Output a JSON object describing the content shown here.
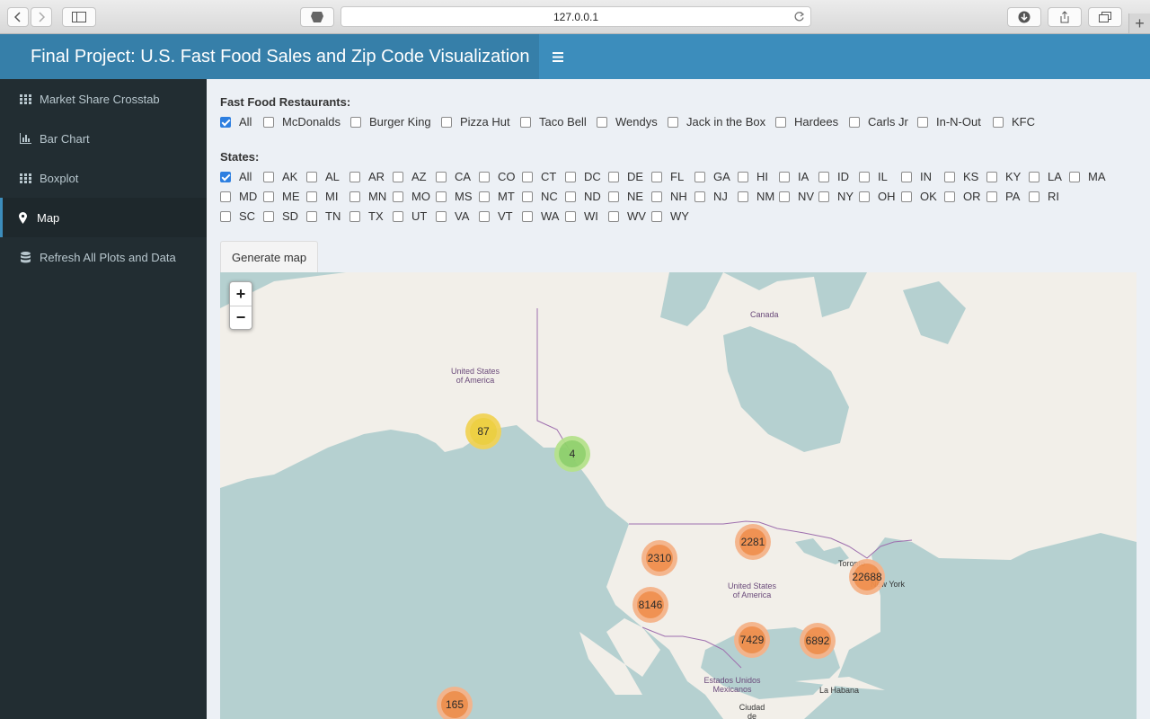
{
  "browser": {
    "url": "127.0.0.1"
  },
  "header": {
    "title": "Final Project: U.S. Fast Food Sales and Zip Code Visualization"
  },
  "sidebar": {
    "items": [
      {
        "label": "Market Share Crosstab",
        "icon": "grid-icon"
      },
      {
        "label": "Bar Chart",
        "icon": "bar-chart-icon"
      },
      {
        "label": "Boxplot",
        "icon": "grid-icon"
      },
      {
        "label": "Map",
        "icon": "map-marker-icon",
        "active": true
      },
      {
        "label": "Refresh All Plots and Data",
        "icon": "database-icon"
      }
    ]
  },
  "restaurants": {
    "label": "Fast Food Restaurants:",
    "options": [
      {
        "label": "All",
        "checked": true
      },
      {
        "label": "McDonalds",
        "checked": false
      },
      {
        "label": "Burger King",
        "checked": false
      },
      {
        "label": "Pizza Hut",
        "checked": false
      },
      {
        "label": "Taco Bell",
        "checked": false
      },
      {
        "label": "Wendys",
        "checked": false
      },
      {
        "label": "Jack in the Box",
        "checked": false
      },
      {
        "label": "Hardees",
        "checked": false
      },
      {
        "label": "Carls Jr",
        "checked": false
      },
      {
        "label": "In-N-Out",
        "checked": false
      },
      {
        "label": "KFC",
        "checked": false
      }
    ]
  },
  "states": {
    "label": "States:",
    "rows": [
      [
        {
          "label": "All",
          "checked": true
        },
        {
          "label": "AK"
        },
        {
          "label": "AL"
        },
        {
          "label": "AR"
        },
        {
          "label": "AZ"
        },
        {
          "label": "CA"
        },
        {
          "label": "CO"
        },
        {
          "label": "CT"
        },
        {
          "label": "DC"
        },
        {
          "label": "DE"
        },
        {
          "label": "FL"
        },
        {
          "label": "GA"
        },
        {
          "label": "HI"
        },
        {
          "label": "IA"
        },
        {
          "label": "ID"
        },
        {
          "label": "IL"
        },
        {
          "label": "IN"
        },
        {
          "label": "KS"
        },
        {
          "label": "KY"
        },
        {
          "label": "LA"
        },
        {
          "label": "MA"
        }
      ],
      [
        {
          "label": "MD"
        },
        {
          "label": "ME"
        },
        {
          "label": "MI"
        },
        {
          "label": "MN"
        },
        {
          "label": "MO"
        },
        {
          "label": "MS"
        },
        {
          "label": "MT"
        },
        {
          "label": "NC"
        },
        {
          "label": "ND"
        },
        {
          "label": "NE"
        },
        {
          "label": "NH"
        },
        {
          "label": "NJ"
        },
        {
          "label": "NM"
        },
        {
          "label": "NV"
        },
        {
          "label": "NY"
        },
        {
          "label": "OH"
        },
        {
          "label": "OK"
        },
        {
          "label": "OR"
        },
        {
          "label": "PA"
        },
        {
          "label": "RI"
        }
      ],
      [
        {
          "label": "SC"
        },
        {
          "label": "SD"
        },
        {
          "label": "TN"
        },
        {
          "label": "TX"
        },
        {
          "label": "UT"
        },
        {
          "label": "VA"
        },
        {
          "label": "VT"
        },
        {
          "label": "WA"
        },
        {
          "label": "WI"
        },
        {
          "label": "WV"
        },
        {
          "label": "WY"
        }
      ]
    ]
  },
  "generate_button": "Generate map",
  "map": {
    "zoom_in": "+",
    "zoom_out": "−",
    "labels": {
      "canada": "Canada",
      "usa_alaska": "United States of America",
      "usa_main": "United States of America",
      "mexico": "Estados Unidos Mexicanos",
      "toronto": "Toronto",
      "new_york": "New York",
      "la_habana": "La Habana",
      "ciudad_mexico": "Ciudad de México"
    },
    "clusters": [
      {
        "count": "87",
        "level": "medium"
      },
      {
        "count": "4",
        "level": "small"
      },
      {
        "count": "2281",
        "level": "large"
      },
      {
        "count": "2310",
        "level": "large"
      },
      {
        "count": "22688",
        "level": "large"
      },
      {
        "count": "8146",
        "level": "large"
      },
      {
        "count": "7429",
        "level": "large"
      },
      {
        "count": "6892",
        "level": "large"
      },
      {
        "count": "165",
        "level": "large"
      }
    ],
    "colors": {
      "small_inner": "#8fd16b",
      "small_outer": "#b5e28c",
      "medium_inner": "#eecf3c",
      "medium_outer": "#f1d357",
      "large_inner": "#f08e4b",
      "large_outer": "#f5b38a"
    }
  }
}
